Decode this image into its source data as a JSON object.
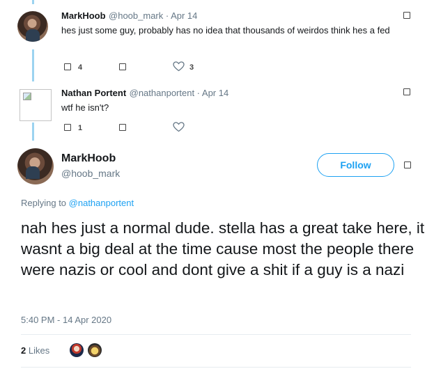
{
  "tweets": [
    {
      "name": "MarkHoob",
      "handle_date": "@hoob_mark · Apr 14",
      "text": "hes just some guy, probably has no idea that thousands of weirdos think hes a fed",
      "reply_count": "4",
      "retweet_count": "",
      "like_count": "3"
    },
    {
      "name": "Nathan Portent",
      "handle_date": "@nathanportent · Apr 14",
      "text": "wtf he isn't?",
      "reply_count": "1",
      "retweet_count": "",
      "like_count": ""
    }
  ],
  "main_tweet": {
    "name": "MarkHoob",
    "handle": "@hoob_mark",
    "follow_label": "Follow",
    "replying_prefix": "Replying to ",
    "replying_to": "@nathanportent",
    "text": "nah hes just a normal dude. stella has a great take here, it wasnt a big deal at the time cause most the people there were nazis or cool and dont give a shit if a guy is a nazi",
    "timestamp": "5:40 PM - 14 Apr 2020",
    "likes_count": "2",
    "likes_label": "Likes"
  },
  "colors": {
    "accent": "#1da1f2",
    "thread_line": "#9cd3f0",
    "muted": "#657786"
  },
  "icons": [
    "reply-icon",
    "retweet-icon",
    "heart-icon",
    "caret-icon",
    "broken-image-icon"
  ]
}
